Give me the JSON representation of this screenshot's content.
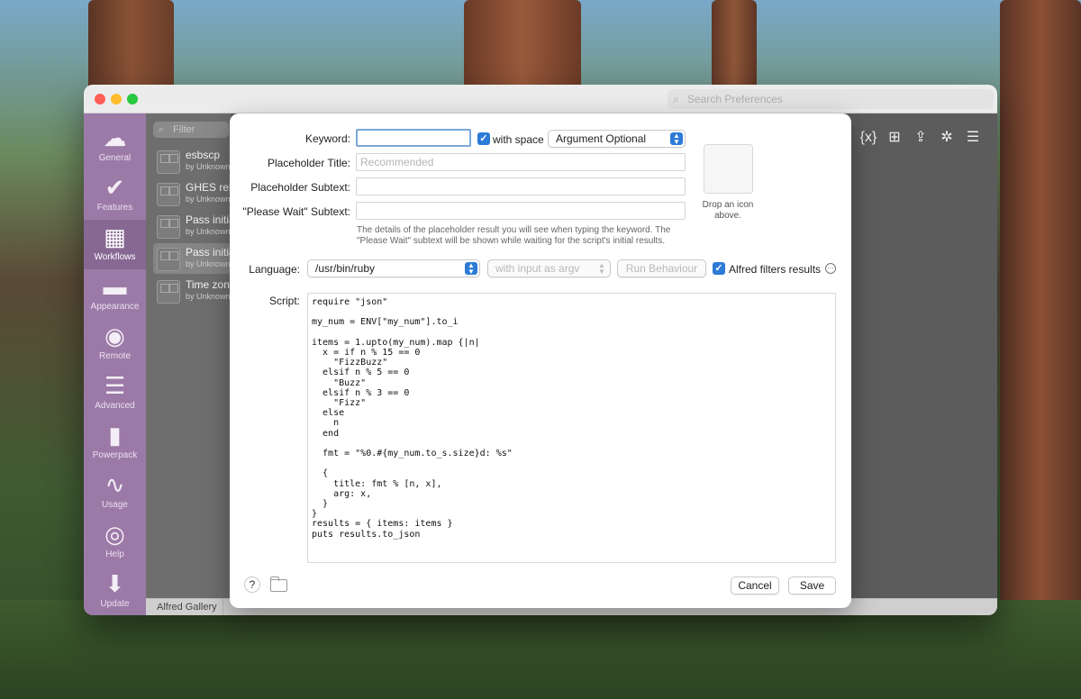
{
  "prefs": {
    "search_placeholder": "Search Preferences",
    "sidebar": [
      {
        "label": "General",
        "icon": "hat-icon",
        "glyph": "☁"
      },
      {
        "label": "Features",
        "icon": "checkmark-icon",
        "glyph": "✔"
      },
      {
        "label": "Workflows",
        "icon": "grid-icon",
        "glyph": "▦"
      },
      {
        "label": "Appearance",
        "icon": "paint-roller-icon",
        "glyph": "▬"
      },
      {
        "label": "Remote",
        "icon": "remote-icon",
        "glyph": "◉"
      },
      {
        "label": "Advanced",
        "icon": "sliders-icon",
        "glyph": "☰"
      },
      {
        "label": "Powerpack",
        "icon": "battery-icon",
        "glyph": "▮"
      },
      {
        "label": "Usage",
        "icon": "chart-line-icon",
        "glyph": "∿"
      },
      {
        "label": "Help",
        "icon": "lifebuoy-icon",
        "glyph": "◎"
      },
      {
        "label": "Update",
        "icon": "download-icon",
        "glyph": "⬇"
      }
    ],
    "filter_placeholder": "Filter",
    "workflows": [
      {
        "name": "esbscp",
        "author": "by Unknown"
      },
      {
        "name": "GHES release",
        "author": "by Unknown"
      },
      {
        "name": "Pass initial",
        "author": "by Unknown"
      },
      {
        "name": "Pass initial",
        "author": "by Unknown"
      },
      {
        "name": "Time zones",
        "author": "by Unknown"
      }
    ],
    "gallery_label": "Alfred Gallery",
    "toolbar": [
      {
        "icon": "variables-icon",
        "glyph": "{x}"
      },
      {
        "icon": "add-object-icon",
        "glyph": "⊞"
      },
      {
        "icon": "share-icon",
        "glyph": "⇪"
      },
      {
        "icon": "debug-bug-icon",
        "glyph": "✲"
      },
      {
        "icon": "notes-lines-icon",
        "glyph": "☰"
      }
    ]
  },
  "sheet": {
    "keyword_label": "Keyword:",
    "keyword_value": "",
    "with_space_label": "with space",
    "argument_option": "Argument Optional",
    "placeholder_title_label": "Placeholder Title:",
    "placeholder_title_placeholder": "Recommended",
    "placeholder_subtext_label": "Placeholder Subtext:",
    "please_wait_label": "\"Please Wait\" Subtext:",
    "help_text": "The details of the placeholder result you will see when typing the keyword. The \"Please Wait\" subtext will be shown while waiting for the script's initial results.",
    "icon_drop_caption": "Drop an icon above.",
    "language_label": "Language:",
    "language_value": "/usr/bin/ruby",
    "input_mode": "with input as argv",
    "run_behaviour_label": "Run Behaviour",
    "alfred_filters_label": "Alfred filters results",
    "script_label": "Script:",
    "script_code": "require \"json\"\n\nmy_num = ENV[\"my_num\"].to_i\n\nitems = 1.upto(my_num).map {|n|\n  x = if n % 15 == 0\n    \"FizzBuzz\"\n  elsif n % 5 == 0\n    \"Buzz\"\n  elsif n % 3 == 0\n    \"Fizz\"\n  else\n    n\n  end\n\n  fmt = \"%0.#{my_num.to_s.size}d: %s\"\n\n  {\n    title: fmt % [n, x],\n    arg: x,\n  }\n}\nresults = { items: items }\nputs results.to_json",
    "help_button_label": "?",
    "cancel_label": "Cancel",
    "save_label": "Save"
  }
}
